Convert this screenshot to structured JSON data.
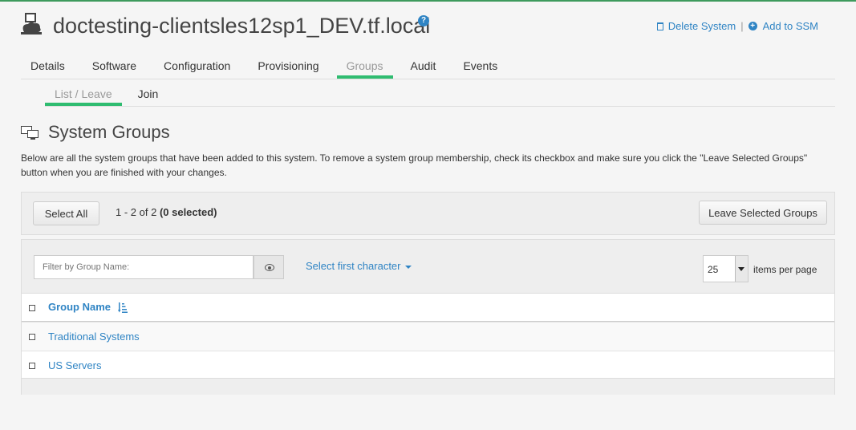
{
  "header": {
    "title": "doctesting-clientsles12sp1_DEV.tf.local",
    "help_icon": "help-icon",
    "delete_label": "Delete System",
    "add_ssm_label": "Add to SSM",
    "separator": "|"
  },
  "tabs": [
    {
      "label": "Details"
    },
    {
      "label": "Software"
    },
    {
      "label": "Configuration"
    },
    {
      "label": "Provisioning"
    },
    {
      "label": "Groups",
      "active": true
    },
    {
      "label": "Audit"
    },
    {
      "label": "Events"
    }
  ],
  "subtabs": [
    {
      "label": "List / Leave",
      "active": true
    },
    {
      "label": "Join"
    }
  ],
  "section": {
    "title": "System Groups",
    "description": "Below are all the system groups that have been added to this system. To remove a system group membership, check its checkbox and make sure you click the \"Leave Selected Groups\" button when you are finished with your changes."
  },
  "toolbar": {
    "select_all": "Select All",
    "range": "1 - 2 of 2",
    "selected": "(0 selected)",
    "leave_button": "Leave Selected Groups"
  },
  "list": {
    "filter_placeholder": "Filter by Group Name:",
    "first_char": "Select first character",
    "per_page_value": "25",
    "per_page_label": "items per page",
    "column_header": "Group Name",
    "rows": [
      {
        "name": "Traditional Systems"
      },
      {
        "name": "US Servers"
      }
    ]
  },
  "colors": {
    "accent": "#2fbc70",
    "link": "#2f84c4",
    "top_bar": "#3e9a5d"
  }
}
